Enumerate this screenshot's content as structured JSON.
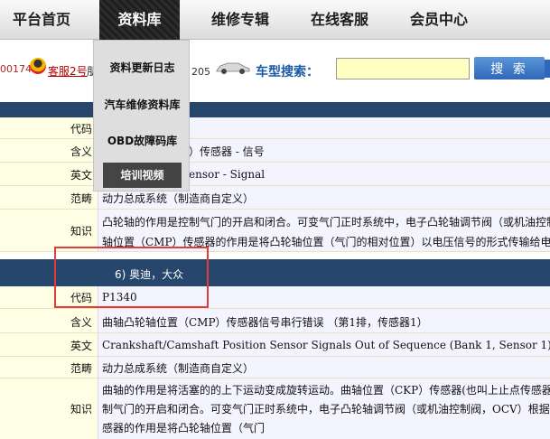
{
  "nav": {
    "items": [
      "平台首页",
      "资料库",
      "维修专辑",
      "在线客服",
      "会员中心"
    ]
  },
  "dropdown": {
    "items": [
      "资料更新日志",
      "汽车维修资料库",
      "OBD故障码库",
      "培训视频"
    ]
  },
  "infobar": {
    "phone_fragment": "00174",
    "kefu_link": "客服2号",
    "kefu_tail": "朋",
    "number": "205",
    "search_label": "车型搜索：",
    "search_value": "",
    "search_button": "搜 索"
  },
  "section1": {
    "rows": [
      {
        "label": "代码",
        "value": ""
      },
      {
        "label": "含义",
        "value": "）传感器 - 信号"
      },
      {
        "label": "英文",
        "value": "ensor - Signal"
      },
      {
        "label": "范畴",
        "value": "动力总成系统（制造商自定义）"
      },
      {
        "label": "知识",
        "lines": [
          "凸轮轴的作用是控制气门的开启和闭合。可变气门正时系统中，电子凸轮轴调节阀（或机油控制",
          "轴位置（CMP）传感器的作用是将凸轮轴位置（气门的相对位置）以电压信号的形式传输给电子"
        ]
      }
    ]
  },
  "section2": {
    "title": "6) 奥迪，大众",
    "rows": [
      {
        "label": "代码",
        "value": "P1340"
      },
      {
        "label": "含义",
        "value": "曲轴凸轮轴位置（CMP）传感器信号串行错误 （第1排，传感器1）"
      },
      {
        "label": "英文",
        "value": "Crankshaft/Camshaft Position Sensor Signals Out of Sequence (Bank 1, Sensor 1)"
      },
      {
        "label": "范畴",
        "value": "动力总成系统（制造商自定义）"
      },
      {
        "label": "知识",
        "lines": [
          "曲轴的作用是将活塞的的上下运动变成旋转运动。曲轴位置（CKP）传感器(也叫上止点传感器",
          "制气门的开启和闭合。可变气门正时系统中，电子凸轮轴调节阀（或机油控制阀，OCV）根据来",
          "感器的作用是将凸轮轴位置（气门"
        ]
      }
    ]
  }
}
